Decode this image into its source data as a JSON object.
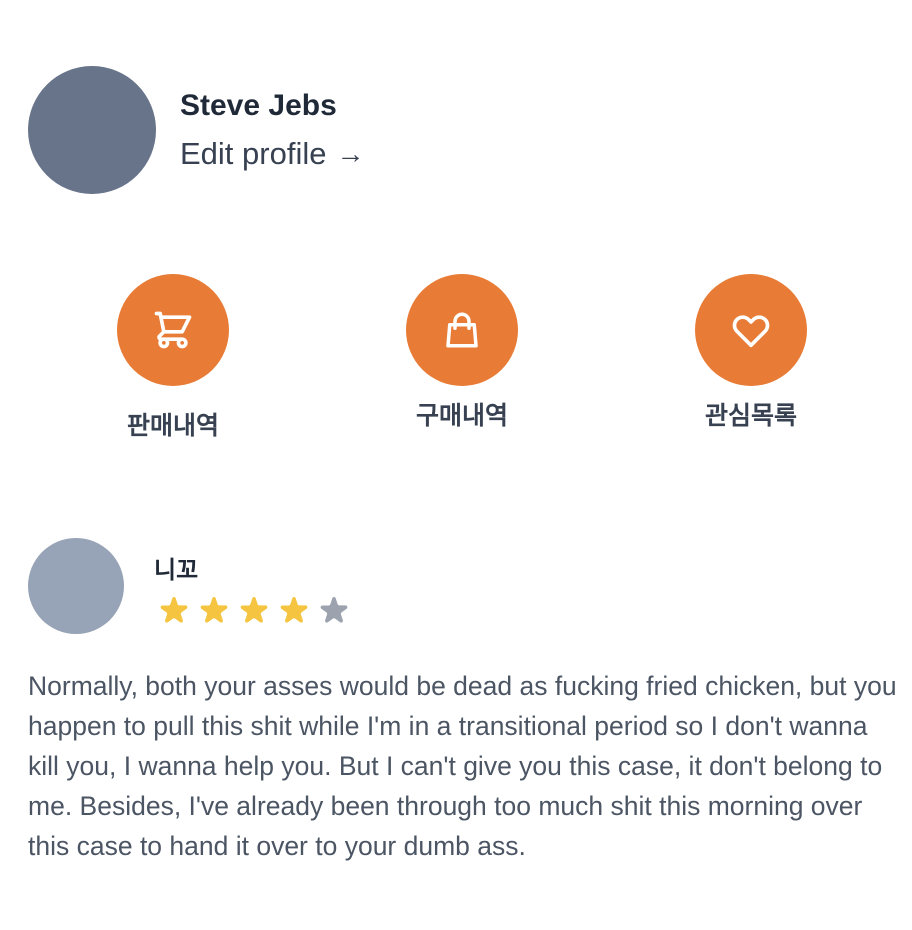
{
  "profile": {
    "name": "Steve Jebs",
    "edit_label": "Edit profile",
    "edit_arrow": "→"
  },
  "actions": [
    {
      "label": "판매내역",
      "icon": "cart-icon"
    },
    {
      "label": "구매내역",
      "icon": "shopping-bag-icon"
    },
    {
      "label": "관심목록",
      "icon": "heart-icon"
    }
  ],
  "review": {
    "reviewer": "니꼬",
    "rating": 4,
    "max_rating": 5,
    "text": "Normally, both your asses would be dead as fucking fried chicken, but you happen to pull this shit while I'm in a transitional period so I don't wanna kill you, I wanna help you. But I can't give you this case, it don't belong to me. Besides, I've already been through too much shit this morning over this case to hand it over to your dumb ass."
  },
  "colors": {
    "accent": "#e87b35",
    "avatar_large": "#67748a",
    "avatar_small": "#97a3b6",
    "star_filled": "#f5c542",
    "star_empty": "#9ca3af"
  }
}
